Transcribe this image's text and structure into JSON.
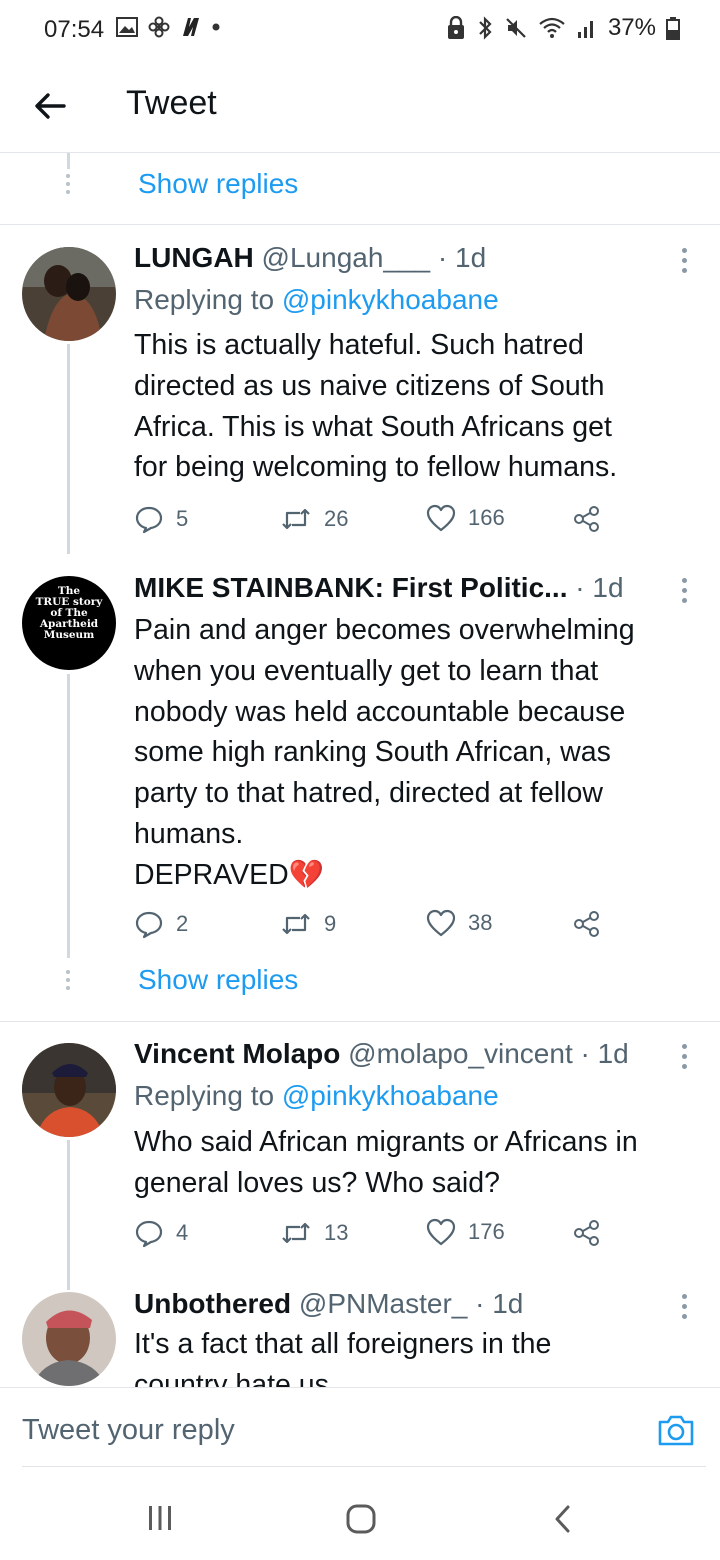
{
  "status_bar": {
    "time": "07:54",
    "battery": "37%"
  },
  "app_bar": {
    "title": "Tweet"
  },
  "show_replies_label": "Show replies",
  "tweets": [
    {
      "display_name": "LUNGAH",
      "meta": "@Lungah___ · 1d",
      "replying_prefix": "Replying to ",
      "replying_to": "@pinkykhoabane",
      "text": "This is actually hateful.  Such hatred\ndirected as us naive citizens of South\nAfrica. This is what South Africans get\nfor being welcoming to fellow humans.",
      "replies": "5",
      "retweets": "26",
      "likes": "166"
    },
    {
      "display_name": "MIKE STAINBANK: First Politic...",
      "meta": " · 1d",
      "avatar_text": [
        "The",
        "TRUE story",
        "of The",
        "Apartheid",
        "Museum"
      ],
      "text": "Pain and anger becomes overwhelming\nwhen you eventually get to learn that\nnobody was held accountable because\nsome high ranking South African, was\nparty to that hatred, directed at fellow\nhumans.\nDEPRAVED",
      "emoji": "💔",
      "replies": "2",
      "retweets": "9",
      "likes": "38"
    },
    {
      "display_name": "Vincent Molapo",
      "meta": "@molapo_vincent · 1d",
      "replying_prefix": "Replying to ",
      "replying_to": "@pinkykhoabane",
      "text": "Who said African migrants or Africans in\ngeneral loves us? Who said?",
      "replies": "4",
      "retweets": "13",
      "likes": "176"
    },
    {
      "display_name": "Unbothered",
      "meta": "@PNMaster_ · 1d",
      "text": "It's a fact that all foreigners in the\ncountry hate us"
    }
  ],
  "composer": {
    "placeholder": "Tweet your reply"
  },
  "icons": {
    "accent": "#1d9bf0",
    "muted": "#536471"
  }
}
